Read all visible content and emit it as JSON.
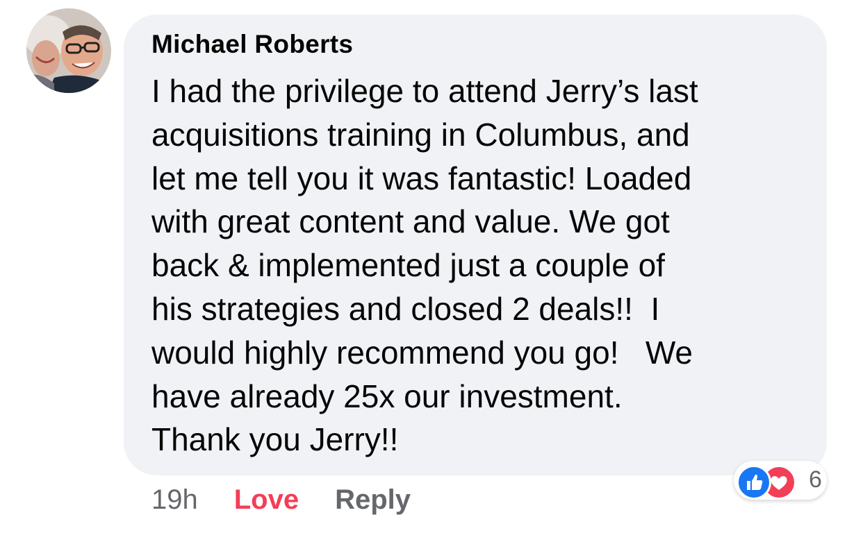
{
  "comment": {
    "author": "Michael Roberts",
    "text_lines": [
      "I had the privilege to attend Jerry’s last",
      "acquisitions training in Columbus, and",
      "let me tell you it was fantastic! Loaded",
      "with great content and value. We got",
      "back & implemented just a couple of",
      "his strategies and closed 2 deals!!  I",
      "would highly recommend you go!   We",
      "have already 25x our investment.",
      "Thank you Jerry!!"
    ],
    "timestamp": "19h",
    "love_label": "Love",
    "reply_label": "Reply",
    "reactions": {
      "icons": [
        "like-icon",
        "heart-icon"
      ],
      "count": "6"
    }
  },
  "colors": {
    "bubble": "#f0f2f5",
    "text": "#050505",
    "muted": "#65676b",
    "love": "#f33e58",
    "like": "#1877f2"
  }
}
